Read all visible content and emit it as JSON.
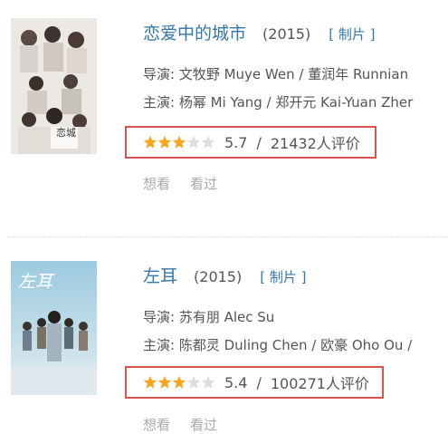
{
  "movies": [
    {
      "title": "恋爱中的城市",
      "year": "(2015)",
      "tag": "[ 制片 ]",
      "director": "导演: 文牧野 Muye Wen / 董润年 Runnian",
      "cast": "主演: 杨幂 Mi Yang / 郑开元 Kai-Yuan Zher",
      "stars_filled": 3,
      "stars_total": 5,
      "score": "5.7",
      "sep": "/",
      "votes": "21432人评价",
      "actions": [
        "想看",
        "看过"
      ],
      "poster_text": "恋城"
    },
    {
      "title": "左耳",
      "year": "(2015)",
      "tag": "[ 制片 ]",
      "director": "导演: 苏有朋 Alec Su",
      "cast": "主演: 陈都灵 Duling Chen / 欧豪 Oho Ou /",
      "stars_filled": 3,
      "stars_total": 5,
      "score": "5.4",
      "sep": "/",
      "votes": "100271人评价",
      "actions": [
        "想看",
        "看过"
      ],
      "poster_text": "左耳"
    }
  ],
  "colors": {
    "title": "#3377aa",
    "star_filled": "#f5a623",
    "star_empty": "#dddddd",
    "highlight_border": "#d9534f"
  }
}
